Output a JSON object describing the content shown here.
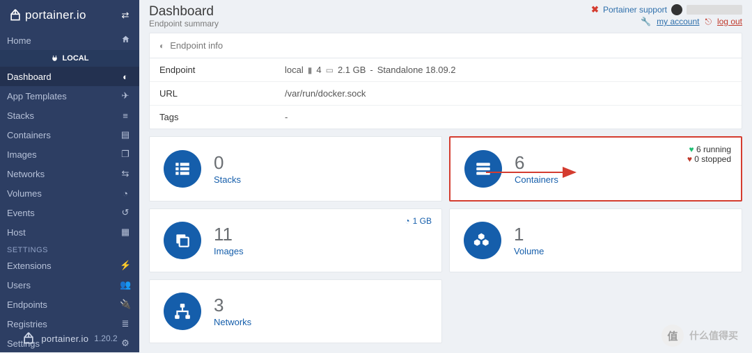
{
  "brand": "portainer.io",
  "version": "1.20.2",
  "header": {
    "title": "Dashboard",
    "subtitle": "Endpoint summary",
    "support": "Portainer support",
    "my_account": "my account",
    "log_out": "log out"
  },
  "sidebar": {
    "home": "Home",
    "local_section": "LOCAL",
    "items": [
      "Dashboard",
      "App Templates",
      "Stacks",
      "Containers",
      "Images",
      "Networks",
      "Volumes",
      "Events",
      "Host"
    ],
    "settings_header": "SETTINGS",
    "settings": [
      "Extensions",
      "Users",
      "Endpoints",
      "Registries",
      "Settings"
    ]
  },
  "endpoint_info": {
    "panel_title": "Endpoint info",
    "rows": {
      "endpoint_k": "Endpoint",
      "endpoint_name": "local",
      "endpoint_cpus": "4",
      "endpoint_mem": "2.1 GB",
      "endpoint_mode": "Standalone 18.09.2",
      "url_k": "URL",
      "url_v": "/var/run/docker.sock",
      "tags_k": "Tags",
      "tags_v": "-"
    }
  },
  "tiles": {
    "stacks": {
      "count": "0",
      "label": "Stacks"
    },
    "containers": {
      "count": "6",
      "label": "Containers",
      "running": "6 running",
      "stopped": "0 stopped"
    },
    "images": {
      "count": "11",
      "label": "Images",
      "size": "1 GB"
    },
    "volumes": {
      "count": "1",
      "label": "Volume"
    },
    "networks": {
      "count": "3",
      "label": "Networks"
    }
  },
  "watermark": "什么值得买"
}
